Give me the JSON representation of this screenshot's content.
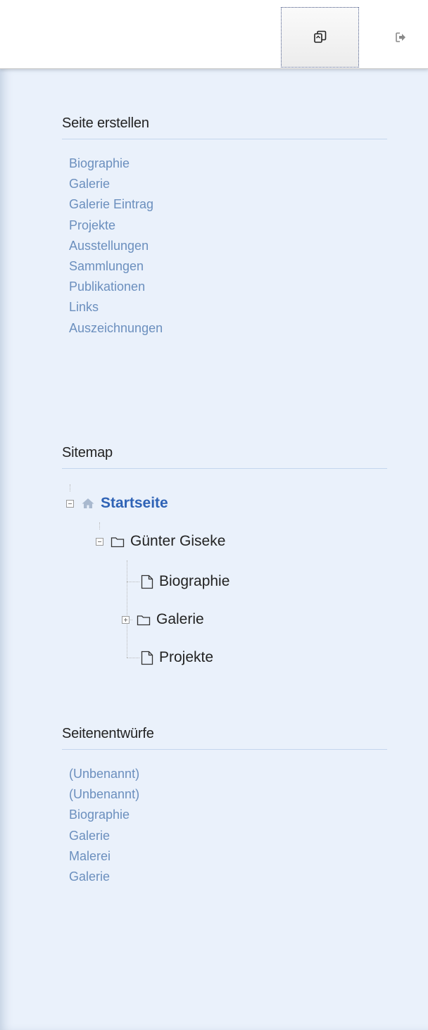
{
  "toolbar": {
    "buttons": [
      {
        "icon": "copy-pages-icon",
        "active": true
      },
      {
        "icon": "logout-icon",
        "active": false
      }
    ]
  },
  "create_page": {
    "title": "Seite erstellen",
    "items": [
      "Biographie",
      "Galerie",
      "Galerie Eintrag",
      "Projekte",
      "Ausstellungen",
      "Sammlungen",
      "Publikationen",
      "Links",
      "Auszeichnungen"
    ]
  },
  "sitemap": {
    "title": "Sitemap",
    "root": "Startseite",
    "folder": "Günter Giseke",
    "children": [
      "Biographie",
      "Galerie",
      "Projekte"
    ]
  },
  "drafts": {
    "title": "Seitenentwürfe",
    "items": [
      "(Unbenannt)",
      "(Unbenannt)",
      "Biographie",
      "Galerie",
      "Malerei",
      "Galerie"
    ]
  },
  "colors": {
    "link": "#6b8fbe",
    "root_link": "#2f63b6",
    "panel_bg": "#eaf1fb"
  }
}
